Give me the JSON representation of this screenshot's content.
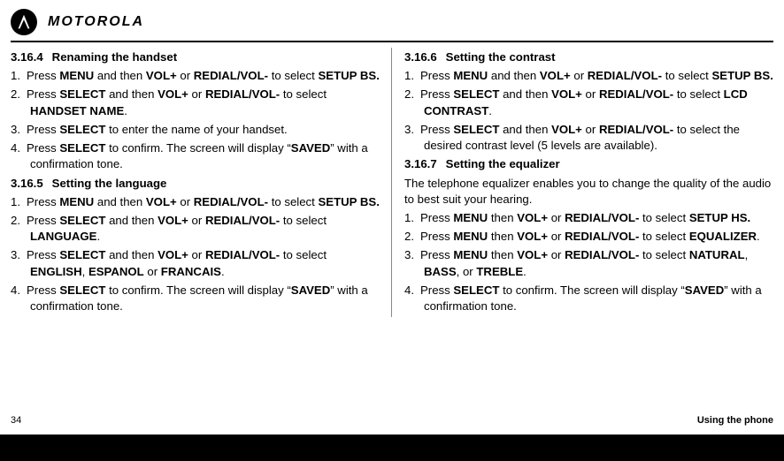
{
  "brand": "MOTOROLA",
  "footer": {
    "page_number": "34",
    "section": "Using the phone"
  },
  "left": {
    "s1": {
      "num": "3.16.4",
      "title": "Renaming the handset",
      "items": [
        "Press <b>MENU</b> and then <b>VOL+</b> or <b>REDIAL/VOL-</b> to select <b>SETUP BS.</b>",
        "Press <b>SELECT</b> and then <b>VOL+</b> or <b>REDIAL/VOL-</b> to select <b>HANDSET NAME</b>.",
        "Press <b>SELECT</b> to enter the name of your handset.",
        "Press <b>SELECT</b> to confirm. The screen will display “<b>SAVED</b>” with a confirmation tone."
      ]
    },
    "s2": {
      "num": "3.16.5",
      "title": "Setting the language",
      "items": [
        "Press <b>MENU</b> and then <b>VOL+</b> or <b>REDIAL/VOL-</b> to select <b>SETUP BS.</b>",
        "Press <b>SELECT</b> and then <b>VOL+</b> or <b>REDIAL/VOL-</b> to select <b>LANGUAGE</b>.",
        "Press <b>SELECT</b> and then <b>VOL+</b> or <b>REDIAL/VOL-</b> to select <b>ENGLISH</b>, <b>ESPANOL</b> or <b>FRANCAIS</b>.",
        "Press <b>SELECT</b> to confirm. The screen will display “<b>SAVED</b>” with a confirmation tone."
      ]
    }
  },
  "right": {
    "s1": {
      "num": "3.16.6",
      "title": "Setting the contrast",
      "items": [
        "Press <b>MENU</b> and then <b>VOL+</b> or <b>REDIAL/VOL-</b> to select <b>SETUP BS.</b>",
        "Press <b>SELECT</b> and then <b>VOL+</b> or <b>REDIAL/VOL-</b> to select <b>LCD CONTRAST</b>.",
        "Press <b>SELECT</b> and then <b>VOL+</b> or <b>REDIAL/VOL-</b> to select the desired contrast level (5 levels are available)."
      ]
    },
    "s2": {
      "num": "3.16.7",
      "title": "Setting the equalizer",
      "intro": "The telephone equalizer enables you to change the quality of the audio to best suit your hearing.",
      "items": [
        "Press <b>MENU</b> then <b>VOL+</b> or <b>REDIAL/VOL-</b>  to select <b>SETUP HS.</b>",
        "Press <b>MENU</b> then <b>VOL+</b> or <b>REDIAL/VOL-</b>  to select <b>EQUALIZER</b>.",
        "Press <b>MENU</b> then <b>VOL+</b> or <b>REDIAL/VOL-</b>  to select <b>NATURAL</b>, <b>BASS</b>, or <b>TREBLE</b>.",
        "Press <b>SELECT</b> to confirm. The screen will display “<b>SAVED</b>” with a confirmation tone."
      ]
    }
  }
}
